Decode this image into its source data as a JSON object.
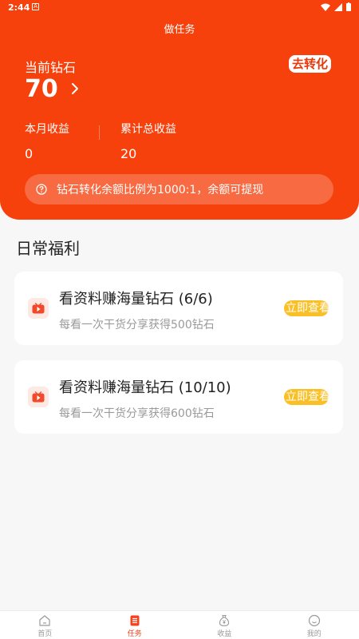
{
  "status_bar": {
    "time": "2:44",
    "notif_icon": "A"
  },
  "header": {
    "title": "做任务",
    "diamond_label": "当前钻石",
    "diamond_value": "70",
    "convert_label": "去转化",
    "month_label": "本月收益",
    "month_value": "0",
    "total_label": "累计总收益",
    "total_value": "20",
    "notice": "钻石转化余额比例为1000:1，余额可提现"
  },
  "section": {
    "title": "日常福利"
  },
  "tasks": [
    {
      "title": "看资料赚海量钻石 (6/6)",
      "subtitle": "每看一次干货分享获得500钻石",
      "button": "立即查看",
      "icon": "video-icon"
    },
    {
      "title": "看资料赚海量钻石 (10/10)",
      "subtitle": "每看一次干货分享获得600钻石",
      "button": "立即查看",
      "icon": "video-icon"
    }
  ],
  "bottom_nav": [
    {
      "label": "首页",
      "icon": "home-icon",
      "active": false
    },
    {
      "label": "任务",
      "icon": "task-list-icon",
      "active": true
    },
    {
      "label": "收益",
      "icon": "money-bag-icon",
      "active": false
    },
    {
      "label": "我的",
      "icon": "smile-icon",
      "active": false
    }
  ],
  "colors": {
    "primary": "#f6410c",
    "button": "#f9bf24",
    "active_nav": "#f3421e"
  }
}
